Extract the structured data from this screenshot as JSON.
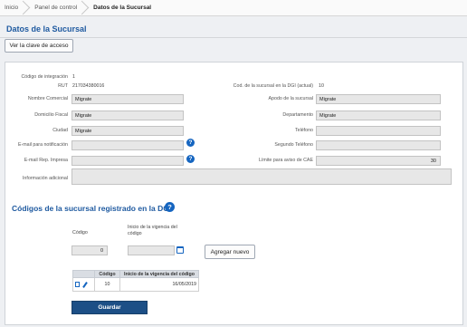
{
  "breadcrumb": [
    "Inicio",
    "Panel de control",
    "Datos de la Sucursal"
  ],
  "page_title": "Datos de la Sucursal",
  "access_key_button": "Ver la clave de acceso",
  "form": {
    "integration_code_label": "Código de integración",
    "integration_code_value": "1",
    "rut_label": "RUT",
    "rut_value": "217034380016",
    "dgi_code_label": "Cod. de la sucursal en la DGI (actual)",
    "dgi_code_value": "10",
    "nombre_comercial_label": "Nombre Comercial",
    "nombre_comercial_value": "Migrate",
    "apodo_label": "Apodo de la sucursal",
    "apodo_value": "Migrate",
    "domicilio_label": "Domicilio Fiscal",
    "domicilio_value": "Migrate",
    "departamento_label": "Departamento",
    "departamento_value": "Migrate",
    "ciudad_label": "Ciudad",
    "ciudad_value": "Migrate",
    "telefono_label": "Teléfono",
    "telefono_value": "",
    "email_notif_label": "E-mail para notificación",
    "email_notif_value": "",
    "segundo_tel_label": "Segundo Teléfono",
    "segundo_tel_value": "",
    "email_rep_label": "E-mail Rep. Impresa",
    "email_rep_value": "",
    "cae_limit_label": "Límite para aviso de CAE",
    "cae_limit_value": "30",
    "info_label": "Información adicional",
    "info_value": ""
  },
  "dgi_section": {
    "title": "Códigos de la sucursal registrado en la DGI",
    "codigo_label": "Código",
    "vigencia_label": "Inicio de la vigencia del código",
    "codigo_input": "0",
    "vigencia_input": "",
    "add_button": "Agregar nuevo",
    "table": {
      "headers": [
        "",
        "Código",
        "Inicio de la vigencia del código"
      ],
      "rows": [
        {
          "codigo": "10",
          "vigencia": "16/05/2019"
        }
      ]
    }
  },
  "save_button": "Guardar",
  "colors": {
    "accent": "#1f5aa0",
    "help_icon": "#1565c0",
    "save_button": "#1d4f86"
  },
  "icons": [
    "help-icon",
    "calendar-icon",
    "document-icon",
    "pencil-icon"
  ]
}
